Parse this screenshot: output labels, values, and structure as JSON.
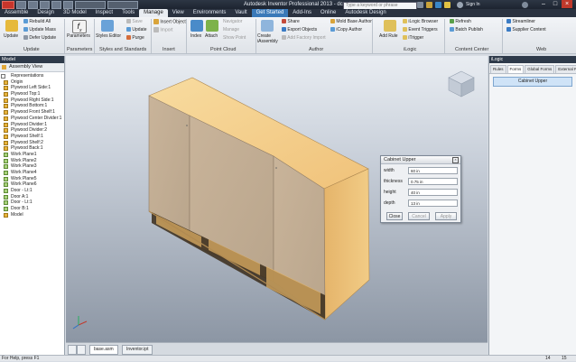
{
  "window": {
    "title": "Autodesk Inventor Professional 2013 - dc-art",
    "search_placeholder": "Type a keyword or phrase",
    "sign_in": "Sign In"
  },
  "menu_tabs": [
    "Assemble",
    "Design",
    "3D Model",
    "Inspect",
    "Tools",
    "Manage",
    "View",
    "Environments",
    "Vault",
    "Get Started",
    "Add-Ins",
    "Online",
    "Autodesk Design"
  ],
  "active_tab": "Manage",
  "ribbon": {
    "update": {
      "big": "Update",
      "rebuild_all": "Rebuild All",
      "update_mass": "Update Mass",
      "defer_update": "Defer Update",
      "group": "Update"
    },
    "parameters": {
      "big": "Parameters",
      "group": "Parameters"
    },
    "styles": {
      "styles_editor": "Styles Editor",
      "save": "Save",
      "update": "Update",
      "purge": "Purge",
      "group": "Styles and Standards"
    },
    "insert": {
      "insert_object": "Insert Object",
      "import": "Import",
      "group": "Insert"
    },
    "point_cloud": {
      "index": "Index",
      "attach": "Attach",
      "navigator": "Navigator",
      "manage": "Manage",
      "show_point": "Show Point",
      "group": "Point Cloud"
    },
    "author": {
      "create_iassembly": "Create iAssembly",
      "share": "Share",
      "export_objects": "Export Objects",
      "add_factory_import": "Add Factory Import",
      "mold_base_author": "Mold Base Author",
      "icopy_author": "iCopy Author",
      "group": "Author"
    },
    "ilogic": {
      "add_rule": "Add Rule",
      "ilogic_browser": "iLogic Browser",
      "event_triggers": "Event Triggers",
      "itrigger": "iTrigger",
      "group": "iLogic"
    },
    "content_center": {
      "refresh": "Refresh",
      "batch_publish": "Batch Publish",
      "group": "Content Center"
    },
    "web": {
      "streamliner": "Streamliner",
      "supplier_content": "Supplier Content",
      "group": "Web"
    }
  },
  "browser": {
    "title": "Model",
    "view": "Assembly View",
    "items": [
      "Representations",
      "Origin",
      "Plywood Left Side:1",
      "Plywood Top:1",
      "Plywood Right Side:1",
      "Plywood Bottom:1",
      "Plywood Front Shelf:1",
      "Plywood Center Divider:1",
      "Plywood Divider:1",
      "Plywood Divider:2",
      "Plywood Shelf:1",
      "Plywood Shelf:2",
      "Plywood Back:1",
      "Work Plane1",
      "Work Plane2",
      "Work Plane3",
      "Work Plane4",
      "Work Plane5",
      "Work Plane6",
      "Door - Lt:1",
      "Door A:1",
      "Door - Lt:1",
      "Door B:1",
      "Model"
    ]
  },
  "dialog": {
    "title": "Cabinet Upper",
    "fields": [
      {
        "label": "width",
        "value": "60 in"
      },
      {
        "label": "thickness",
        "value": "0.75 in"
      },
      {
        "label": "height",
        "value": "40 in"
      },
      {
        "label": "depth",
        "value": "13 in"
      }
    ],
    "close": "Close",
    "cancel": "Cancel",
    "apply": "Apply"
  },
  "right_panel": {
    "title": "iLogic",
    "tabs": [
      "Rules",
      "Forms",
      "Global Forms",
      "External Rules"
    ],
    "active_tab": "Forms",
    "form_button": "Cabinet Upper"
  },
  "doc_tabs": [
    "base.asm",
    "Inventor.ipt"
  ],
  "status": {
    "help": "For Help, press F1",
    "num1": "14",
    "num2": "15"
  }
}
